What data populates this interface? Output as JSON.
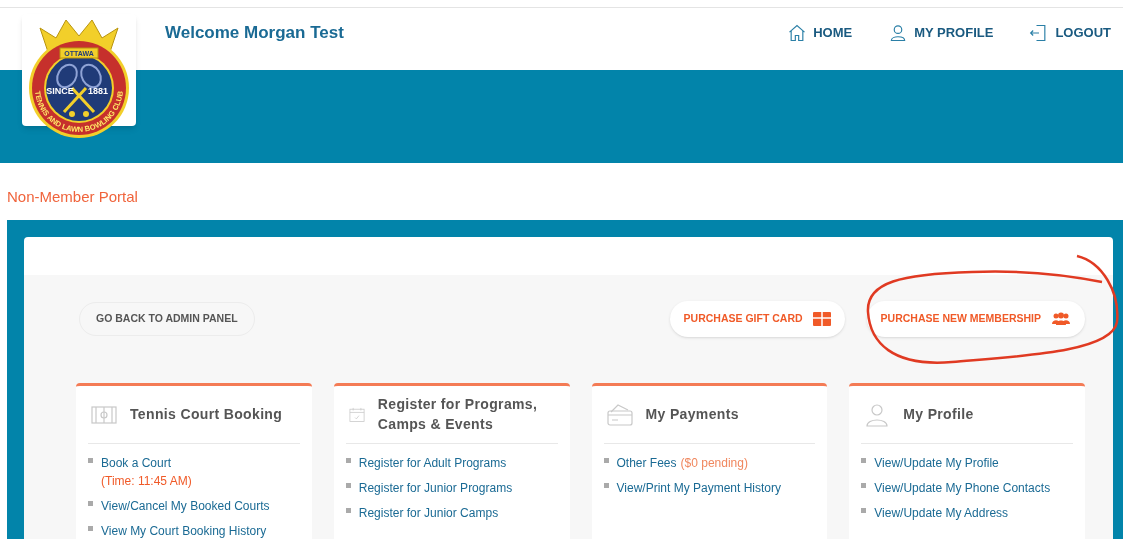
{
  "logo": {
    "banner": "OTTAWA",
    "since": "SINCE",
    "year": "1881",
    "ring": "TENNIS AND LAWN BOWLING CLUB"
  },
  "header": {
    "welcome": "Welcome Morgan Test",
    "nav": [
      {
        "kind": "home",
        "label": "HOME"
      },
      {
        "kind": "profile",
        "label": "MY PROFILE"
      },
      {
        "kind": "logout",
        "label": "LOGOUT"
      }
    ]
  },
  "portal_title": "Non-Member Portal",
  "actions": {
    "back": "GO BACK TO ADMIN PANEL",
    "buttons": [
      {
        "kind": "gift",
        "label": "PURCHASE GIFT CARD"
      },
      {
        "kind": "membership",
        "label": "PURCHASE NEW MEMBERSHIP"
      }
    ]
  },
  "cards": [
    {
      "kind": "court",
      "title": "Tennis Court Booking",
      "items": [
        {
          "label": "Book a Court",
          "note": "(Time: 11:45 AM)"
        },
        {
          "label": "View/Cancel My Booked Courts"
        },
        {
          "label": "View My Court Booking History"
        }
      ]
    },
    {
      "kind": "calendar",
      "title": "Register for Programs, Camps & Events",
      "items": [
        {
          "label": "Register for Adult Programs"
        },
        {
          "label": "Register for Junior Programs"
        },
        {
          "label": "Register for Junior Camps"
        }
      ]
    },
    {
      "kind": "wallet",
      "title": "My Payments",
      "items": [
        {
          "label": "Other Fees",
          "inline_note": "($0 pending)"
        },
        {
          "label": "View/Print My Payment History"
        }
      ]
    },
    {
      "kind": "person",
      "title": "My Profile",
      "items": [
        {
          "label": "View/Update My Profile"
        },
        {
          "label": "View/Update My Phone Contacts"
        },
        {
          "label": "View/Update My Address"
        }
      ]
    }
  ]
}
